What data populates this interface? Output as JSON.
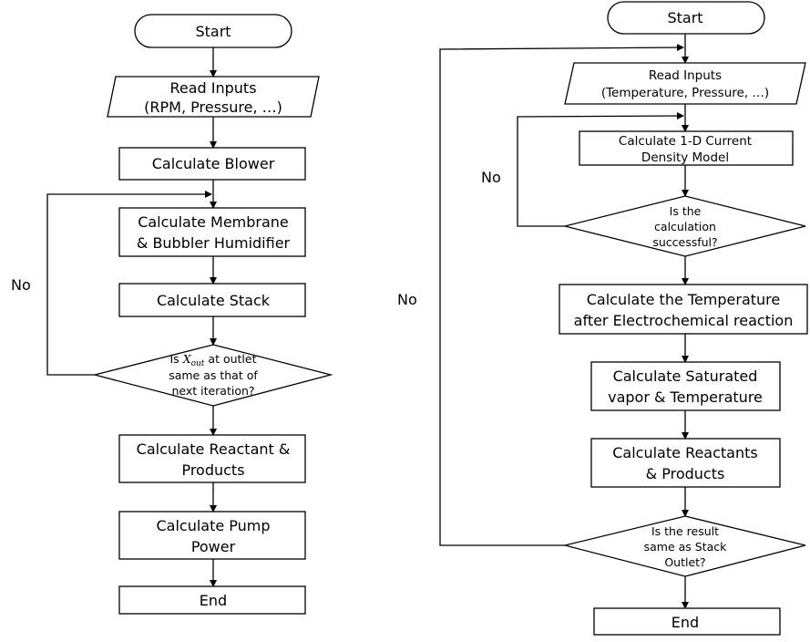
{
  "left": {
    "start": "Start",
    "read_inputs": [
      "Read Inputs",
      "(RPM, Pressure, …)"
    ],
    "blower": "Calculate Blower",
    "membrane": [
      "Calculate Membrane",
      "& Bubbler Humidifier"
    ],
    "stack": "Calculate Stack",
    "decision": {
      "prefix": "Is ",
      "var": "X",
      "sub": "out",
      "suffix": " at outlet",
      "line2": "same as that of",
      "line3": "next iteration?"
    },
    "no_label": "No",
    "reactant": [
      "Calculate Reactant &",
      "Products"
    ],
    "pump": [
      "Calculate Pump",
      "Power"
    ],
    "end": "End"
  },
  "right": {
    "start": "Start",
    "read_inputs": [
      "Read Inputs",
      "(Temperature, Pressure, …)"
    ],
    "current_density": [
      "Calculate 1-D Current",
      "Density Model"
    ],
    "decision1": [
      "Is the",
      "calculation",
      "successful?"
    ],
    "no_label_inner": "No",
    "no_label_outer": "No",
    "temperature": [
      "Calculate the Temperature",
      "after Electrochemical reaction"
    ],
    "saturated": [
      "Calculate Saturated",
      "vapor & Temperature"
    ],
    "reactants": [
      "Calculate Reactants",
      "& Products"
    ],
    "decision2": [
      "Is the result",
      "same as Stack",
      "Outlet?"
    ],
    "end": "End"
  }
}
